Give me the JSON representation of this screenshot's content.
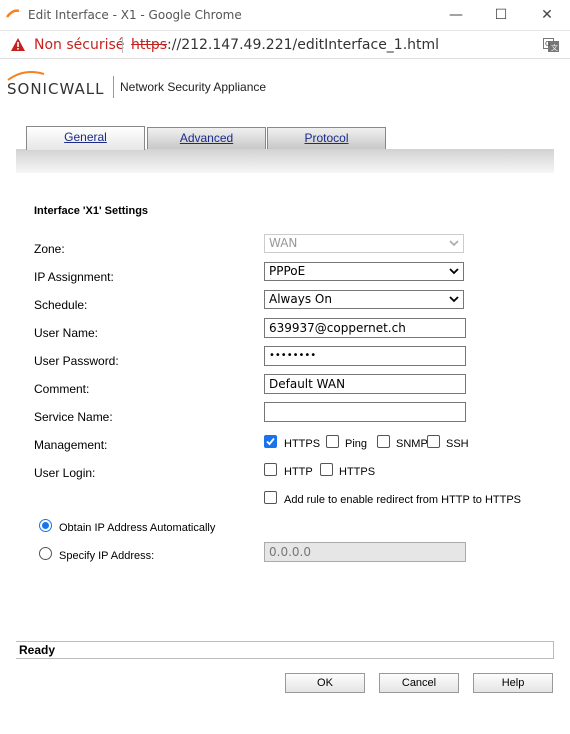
{
  "browser": {
    "window_title": "Edit Interface - X1 - Google Chrome",
    "security_label": "Non sécurisé",
    "url_scheme": "https",
    "url_rest": "://212.147.49.221/editInterface_1.html"
  },
  "header": {
    "brand": "SONICWALL",
    "subtitle": "Network Security Appliance"
  },
  "tabs": [
    {
      "label": "General",
      "active": true
    },
    {
      "label": "Advanced",
      "active": false
    },
    {
      "label": "Protocol",
      "active": false
    }
  ],
  "form": {
    "section_title": "Interface 'X1' Settings",
    "zone": {
      "label": "Zone:",
      "value": "WAN"
    },
    "ip_assignment": {
      "label": "IP Assignment:",
      "value": "PPPoE"
    },
    "schedule": {
      "label": "Schedule:",
      "value": "Always On"
    },
    "user_name": {
      "label": "User Name:",
      "value": "639937@coppernet.ch"
    },
    "user_password": {
      "label": "User Password:",
      "value": "••••••••"
    },
    "comment": {
      "label": "Comment:",
      "value": "Default WAN"
    },
    "service_name": {
      "label": "Service Name:",
      "value": ""
    },
    "management": {
      "label": "Management:",
      "options": [
        {
          "label": "HTTPS",
          "checked": true
        },
        {
          "label": "Ping",
          "checked": false
        },
        {
          "label": "SNMP",
          "checked": false
        },
        {
          "label": "SSH",
          "checked": false
        }
      ]
    },
    "user_login": {
      "label": "User Login:",
      "options": [
        {
          "label": "HTTP",
          "checked": false
        },
        {
          "label": "HTTPS",
          "checked": false
        }
      ]
    },
    "redirect_rule": {
      "label": "Add rule to enable redirect from HTTP to HTTPS",
      "checked": false
    },
    "obtain_auto": {
      "label": "Obtain IP Address Automatically",
      "selected": true
    },
    "specify_ip": {
      "label": "Specify IP Address:",
      "selected": false,
      "value": "0.0.0.0"
    }
  },
  "status": "Ready",
  "buttons": {
    "ok": "OK",
    "cancel": "Cancel",
    "help": "Help"
  },
  "colors": {
    "accent": "#1a73e8",
    "insecure": "#c5221f",
    "brand_orange": "#f58220"
  }
}
